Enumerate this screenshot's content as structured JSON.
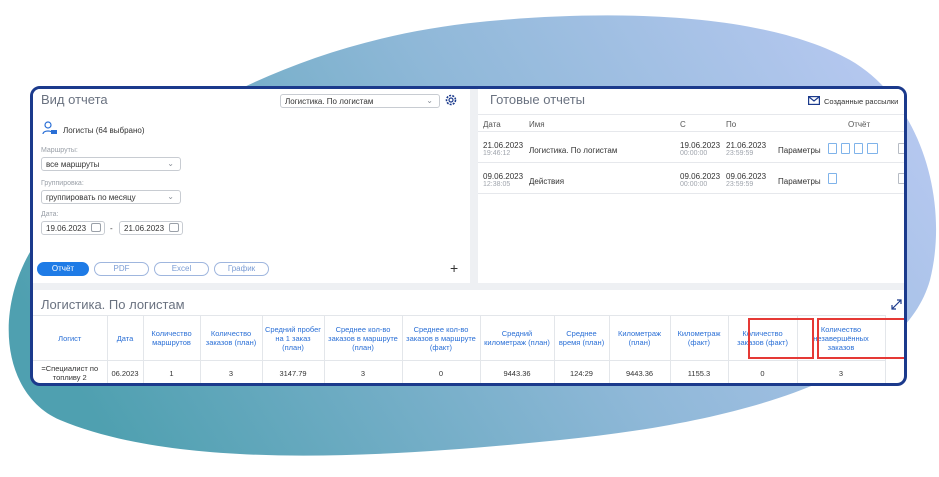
{
  "report_type": {
    "title": "Вид отчета",
    "selected": "Логистика. По логистам",
    "logists_link": "Логисты (64 выбрано)",
    "routes_label": "Маршруты:",
    "routes_value": "все маршруты",
    "grouping_label": "Группировка:",
    "grouping_value": "группировать по месяцу",
    "date_label": "Дата:",
    "date_from": "19.06.2023",
    "date_sep": "-",
    "date_to": "21.06.2023",
    "buttons": {
      "report": "Отчёт",
      "pdf": "PDF",
      "excel": "Excel",
      "chart": "График"
    },
    "add": "+"
  },
  "ready_reports": {
    "title": "Готовые отчеты",
    "mailing_link": "Созданные рассылки",
    "columns": {
      "date": "Дата",
      "name": "Имя",
      "from": "С",
      "to": "По",
      "report": "Отчёт"
    },
    "rows": [
      {
        "date": "21.06.2023",
        "time": "19:46:12",
        "name": "Логистика. По логистам",
        "from": "19.06.2023",
        "from_time": "00:00:00",
        "to": "21.06.2023",
        "to_time": "23:59:59",
        "params": "Параметры"
      },
      {
        "date": "09.06.2023",
        "time": "12:38:05",
        "name": "Действия",
        "from": "09.06.2023",
        "from_time": "00:00:00",
        "to": "09.06.2023",
        "to_time": "23:59:59",
        "params": "Параметры"
      }
    ]
  },
  "result": {
    "title": "Логистика. По логистам",
    "headers": [
      "Логист",
      "Дата",
      "Количество маршрутов",
      "Количество заказов (план)",
      "Средний пробег на 1 заказ (план)",
      "Среднее кол-во заказов в маршруте (план)",
      "Среднее кол-во заказов в маршруте (факт)",
      "Средний километраж (план)",
      "Среднее время (план)",
      "Километраж (план)",
      "Километраж (факт)",
      "Количество заказов (факт)",
      "Количество незавершённых заказов"
    ],
    "row": [
      "=Специалист по топливу 2",
      "06.2023",
      "1",
      "3",
      "3147.79",
      "3",
      "0",
      "9443.36",
      "124:29",
      "9443.36",
      "1155.3",
      "0",
      "3"
    ]
  },
  "colors": {
    "accent": "#2a6fd6",
    "frame": "#1b3a8c",
    "highlight": "#e53935"
  }
}
